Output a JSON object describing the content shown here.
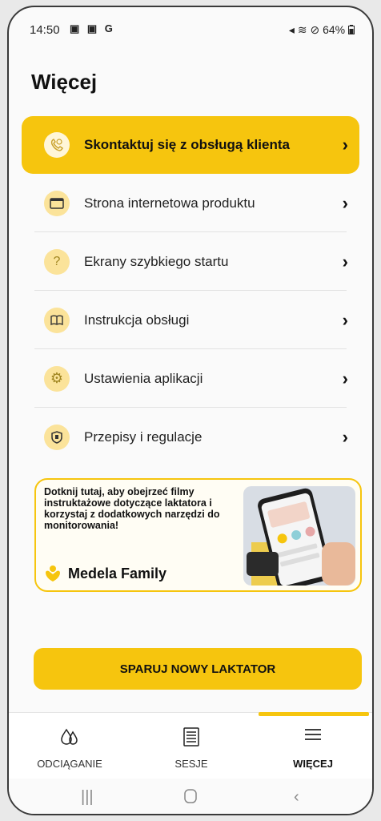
{
  "status": {
    "time": "14:50",
    "left_icons": "▣ ▣ G",
    "right": "64%"
  },
  "page_title": "Więcej",
  "menu": [
    {
      "label": "Skontaktuj się z obsługą klienta",
      "icon": "phone-icon",
      "active": true
    },
    {
      "label": "Strona internetowa produktu",
      "icon": "browser-window-icon"
    },
    {
      "label": "Ekrany szybkiego startu",
      "icon": "question-icon"
    },
    {
      "label": "Instrukcja obsługi",
      "icon": "book-icon"
    },
    {
      "label": "Ustawienia aplikacji",
      "icon": "gear-icon"
    },
    {
      "label": "Przepisy i regulacje",
      "icon": "shield-icon"
    }
  ],
  "promo": {
    "text": "Dotknij tutaj, aby obejrzeć filmy instruktażowe dotyczące laktatora i korzystaj z dodatkowych narzędzi do monitorowania!",
    "brand": "Medela Family"
  },
  "cta_label": "SPARUJ NOWY LAKTATOR",
  "tabs": [
    {
      "label": "ODCIĄGANIE",
      "icon": "drops-icon"
    },
    {
      "label": "SESJE",
      "icon": "list-icon"
    },
    {
      "label": "WIĘCEJ",
      "icon": "menu-icon",
      "active": true
    }
  ],
  "colors": {
    "accent": "#f6c50e",
    "icon_bg": "#fbe39a"
  }
}
